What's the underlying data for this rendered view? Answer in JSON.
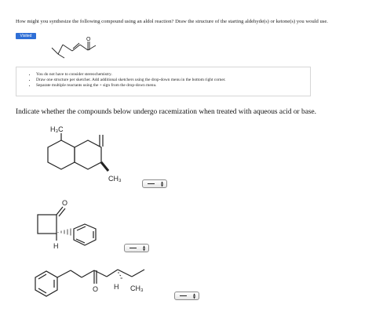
{
  "question": "How might you synthesize the following compound using an aldol reaction? Draw the structure of the starting aldehyde(s) or ketone(s) you would use.",
  "badge": "Visited",
  "instructions": [
    "You do not have to consider stereochemistry.",
    "Draw one structure per sketcher. Add additional sketchers using the drop-down menu in the bottom right corner.",
    "Separate multiple reactants using the + sign from the drop-down menu."
  ],
  "prompt": "Indicate whether the compounds below undergo racemization when treated with aqueous acid or base.",
  "molecules": {
    "top_atom": "O",
    "m1": {
      "h3c": "H₃C",
      "ch3": "CH₃"
    },
    "m2": {
      "o": "O",
      "h": "H"
    },
    "m3": {
      "o": "O",
      "h": "H",
      "ch3": "CH₃"
    }
  },
  "dropdowns": [
    {
      "id": "racemization-select-1",
      "value": "--"
    },
    {
      "id": "racemization-select-2",
      "value": "--"
    },
    {
      "id": "racemization-select-3",
      "value": "--"
    }
  ]
}
